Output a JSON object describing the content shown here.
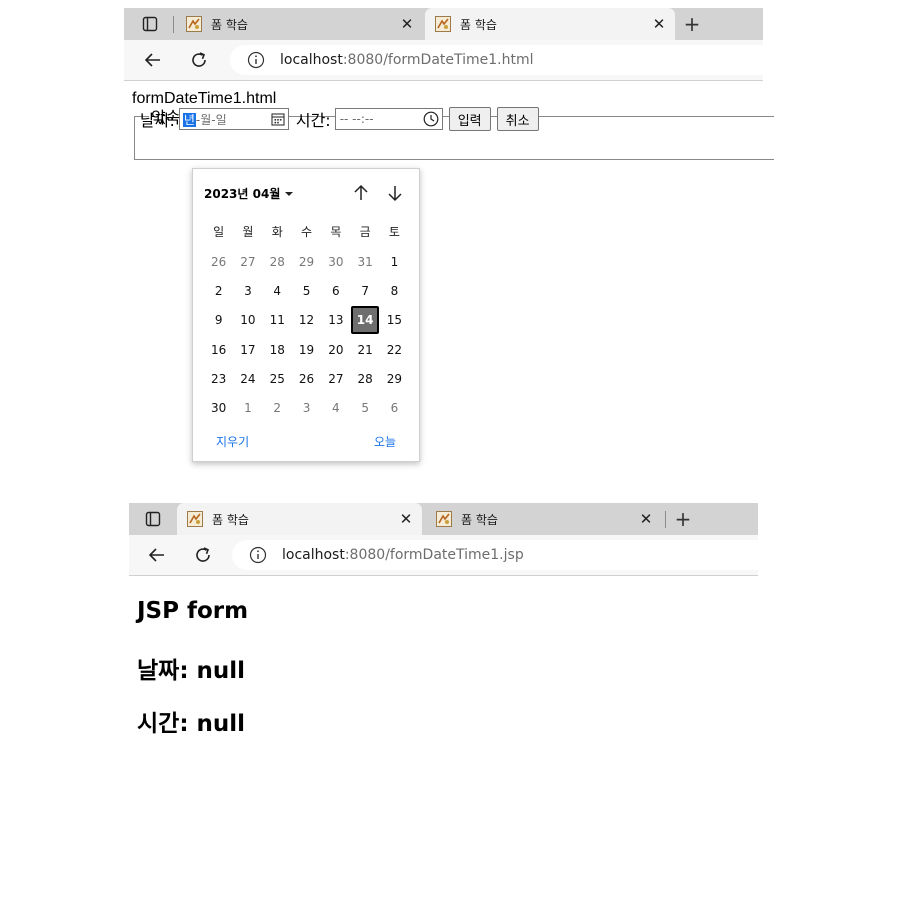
{
  "window1": {
    "tabs": [
      {
        "title": "폼 학습"
      },
      {
        "title": "폼 학습"
      }
    ],
    "url_host": "localhost",
    "url_rest": ":8080/formDateTime1.html"
  },
  "form_page": {
    "file_name": "formDateTime1.html",
    "legend": "약속 날짜 시간 입력",
    "date_label": "날짜:",
    "date_placeholder_year": "년",
    "date_placeholder_rest": "-월-일",
    "time_label": "시간:",
    "time_placeholder": "-- --:--",
    "submit_label": "입력",
    "cancel_label": "취소"
  },
  "calendar": {
    "month_label": "2023년 04월",
    "weekdays": [
      "일",
      "월",
      "화",
      "수",
      "목",
      "금",
      "토"
    ],
    "weeks": [
      [
        "26",
        "27",
        "28",
        "29",
        "30",
        "31",
        "1"
      ],
      [
        "2",
        "3",
        "4",
        "5",
        "6",
        "7",
        "8"
      ],
      [
        "9",
        "10",
        "11",
        "12",
        "13",
        "14",
        "15"
      ],
      [
        "16",
        "17",
        "18",
        "19",
        "20",
        "21",
        "22"
      ],
      [
        "23",
        "24",
        "25",
        "26",
        "27",
        "28",
        "29"
      ],
      [
        "30",
        "1",
        "2",
        "3",
        "4",
        "5",
        "6"
      ]
    ],
    "selected_day": "14",
    "clear_label": "지우기",
    "today_label": "오늘"
  },
  "window2": {
    "tabs": [
      {
        "title": "폼 학습"
      },
      {
        "title": "폼 학습"
      }
    ],
    "url_host": "localhost",
    "url_rest": ":8080/formDateTime1.jsp"
  },
  "jsp_page": {
    "heading": "JSP form",
    "date_line": "날짜: null",
    "time_line": "시간: null"
  },
  "colors": {
    "accent": "#1a73e8",
    "tabbar": "#d3d3d3",
    "selected_day_bg": "#6e6e6e"
  },
  "icons": [
    "tab-actions-icon",
    "favicon-icon",
    "close-icon",
    "new-tab-icon",
    "back-icon",
    "refresh-icon",
    "info-icon",
    "calendar-icon",
    "clock-icon",
    "dropdown-caret-icon",
    "arrow-up-icon",
    "arrow-down-icon"
  ]
}
